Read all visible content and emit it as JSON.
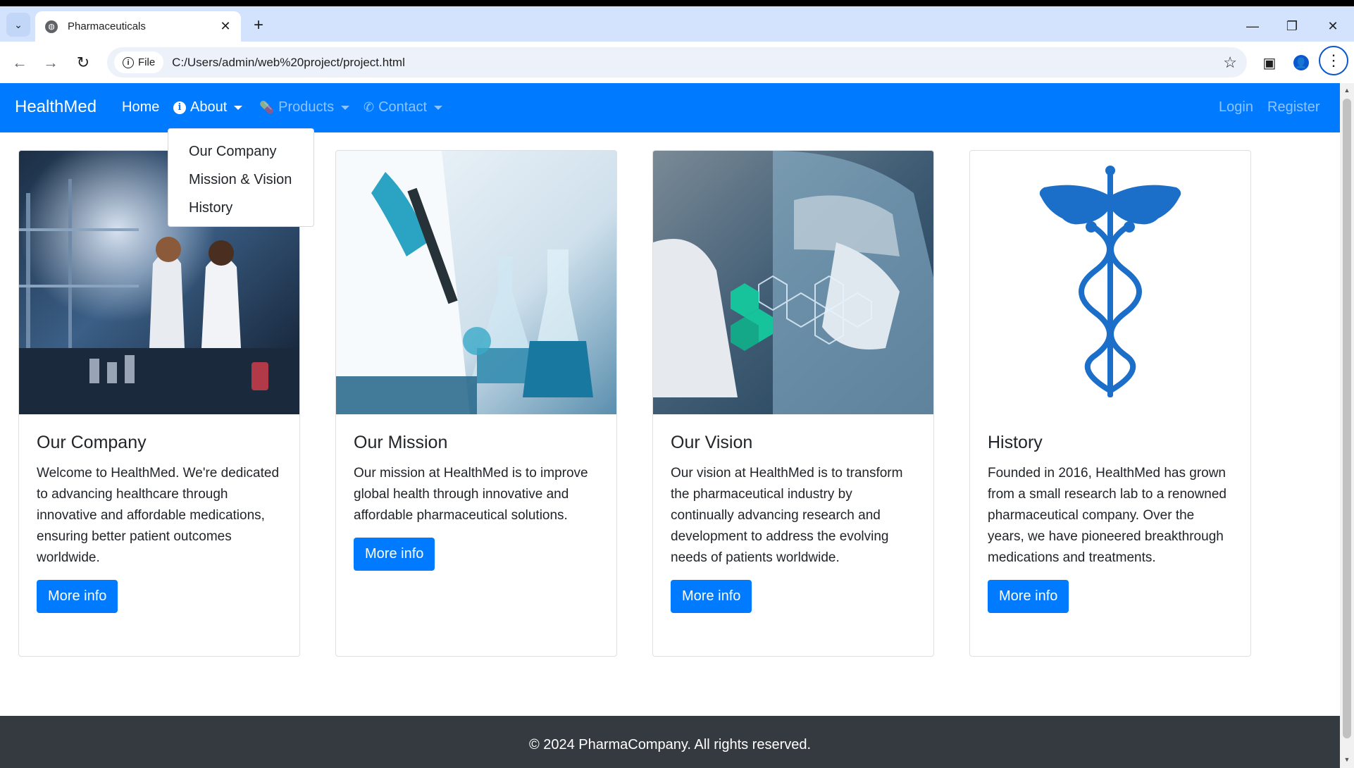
{
  "browser": {
    "tab_title": "Pharmaceuticals",
    "file_chip": "File",
    "url": "C:/Users/admin/web%20project/project.html"
  },
  "navbar": {
    "brand": "HealthMed",
    "home": "Home",
    "about": "About",
    "products": "Products",
    "contact": "Contact",
    "login": "Login",
    "register": "Register"
  },
  "about_dropdown": {
    "items": [
      "Our Company",
      "Mission & Vision",
      "History"
    ]
  },
  "cards": [
    {
      "title": "Our Company",
      "text": "Welcome to HealthMed. We're dedicated to advancing healthcare through innovative and affordable medications, ensuring better patient outcomes worldwide.",
      "button": "More info"
    },
    {
      "title": "Our Mission",
      "text": "Our mission at HealthMed is to improve global health through innovative and affordable pharmaceutical solutions.",
      "button": "More info"
    },
    {
      "title": "Our Vision",
      "text": "Our vision at HealthMed is to transform the pharmaceutical industry by continually advancing research and development to address the evolving needs of patients worldwide.",
      "button": "More info"
    },
    {
      "title": "History",
      "text": "Founded in 2016, HealthMed has grown from a small research lab to a renowned pharmaceutical company. Over the years, we have pioneered breakthrough medications and treatments.",
      "button": "More info"
    }
  ],
  "footer": {
    "text": "© 2024 PharmaCompany. All rights reserved."
  },
  "colors": {
    "primary": "#007bff",
    "footer_bg": "#343a40"
  }
}
